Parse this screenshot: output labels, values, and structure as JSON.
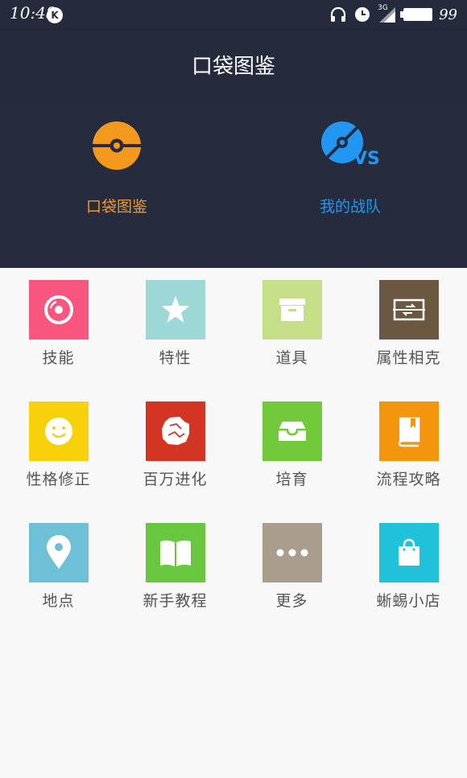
{
  "status_bar": {
    "time": "10:48",
    "notification_badge": "K",
    "network": "3G",
    "battery_level": "99"
  },
  "app_bar": {
    "title": "口袋图鉴"
  },
  "hero": {
    "left": {
      "label": "口袋图鉴",
      "icon": "pokeball-icon",
      "color": "#f39a1e"
    },
    "right": {
      "label": "我的战队",
      "icon": "team-vs-icon",
      "vs_text": "VS",
      "color": "#2196f3"
    }
  },
  "grid": {
    "items": [
      {
        "label": "技能",
        "icon": "disc-icon",
        "color": "#f8567f"
      },
      {
        "label": "特性",
        "icon": "star-icon",
        "color": "#9dd8d6"
      },
      {
        "label": "道具",
        "icon": "box-icon",
        "color": "#c5df88"
      },
      {
        "label": "属性相克",
        "icon": "swap-icon",
        "color": "#6b5841"
      },
      {
        "label": "性格修正",
        "icon": "smiley-icon",
        "color": "#f7d10a"
      },
      {
        "label": "百万进化",
        "icon": "rock-icon",
        "color": "#d43422"
      },
      {
        "label": "培育",
        "icon": "tray-icon",
        "color": "#72c93a"
      },
      {
        "label": "流程攻略",
        "icon": "book-icon",
        "color": "#f3950d"
      },
      {
        "label": "地点",
        "icon": "location-pin-icon",
        "color": "#6dc0d5"
      },
      {
        "label": "新手教程",
        "icon": "open-book-icon",
        "color": "#68c73e"
      },
      {
        "label": "更多",
        "icon": "more-dots-icon",
        "color": "#a99e8e"
      },
      {
        "label": "蜥蜴小店",
        "icon": "shopping-bag-icon",
        "color": "#1fc2d9"
      }
    ]
  }
}
